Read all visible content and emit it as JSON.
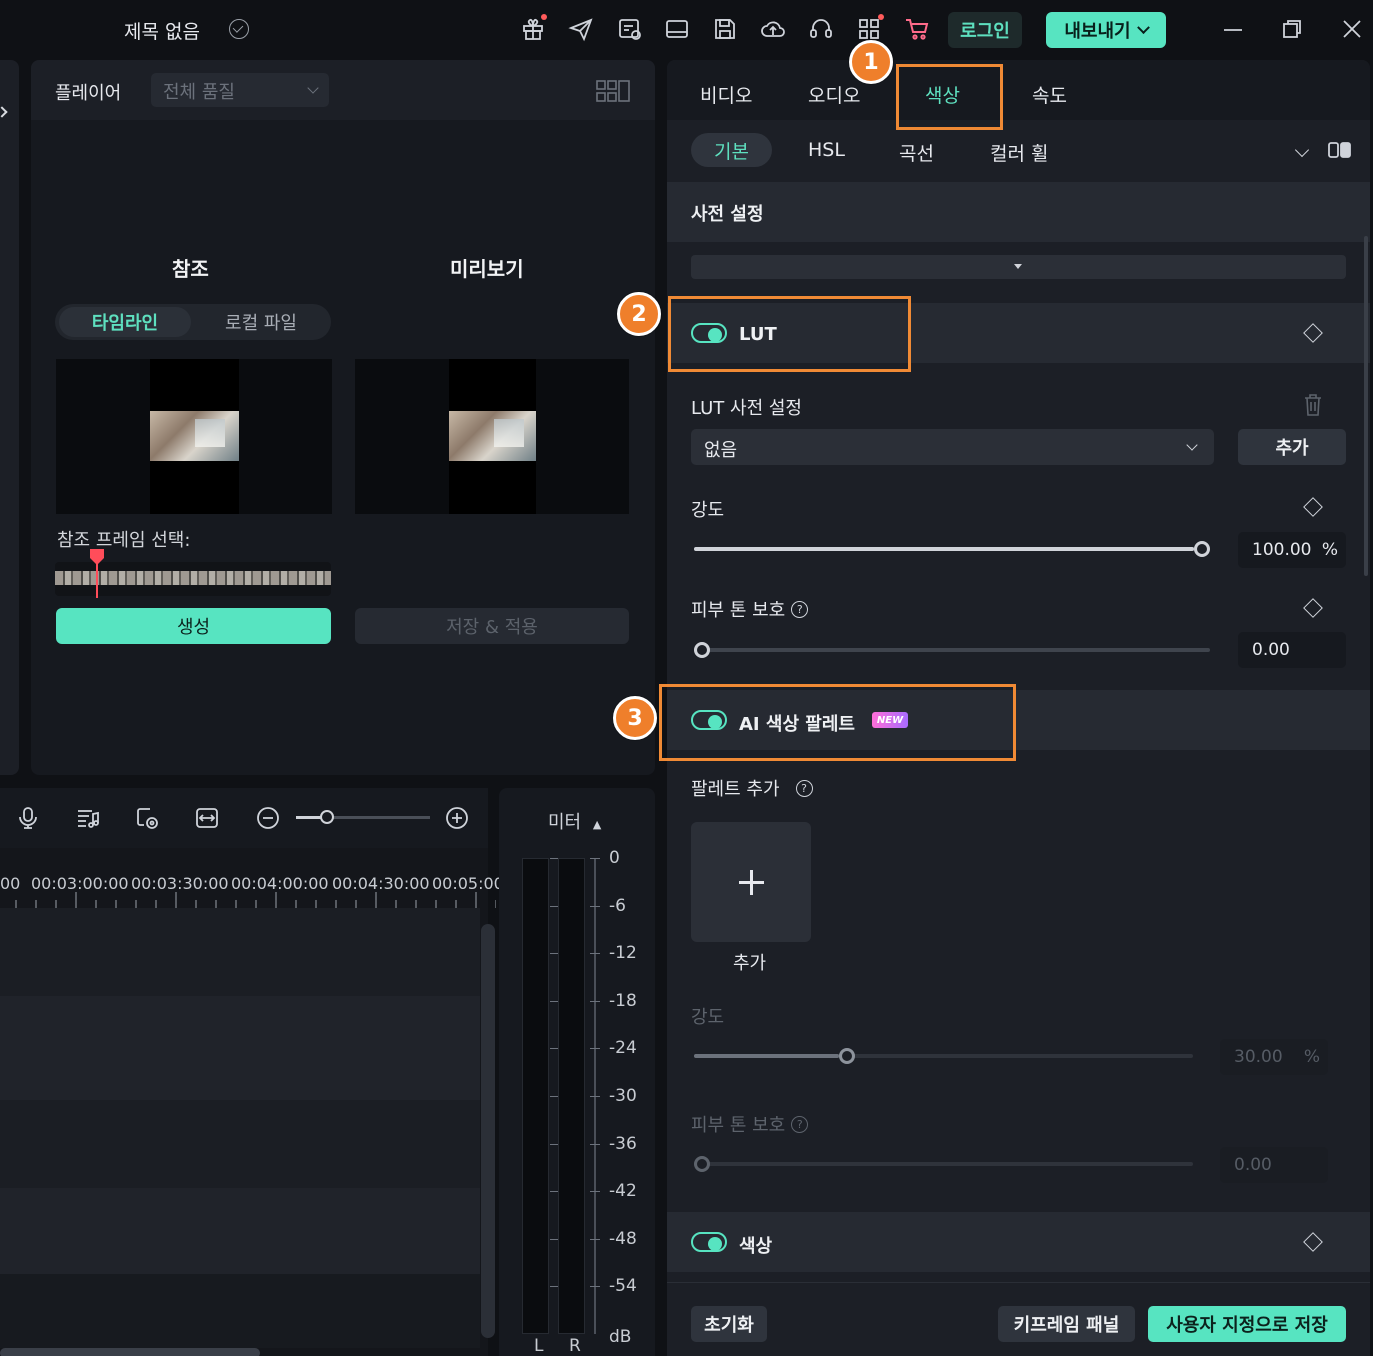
{
  "app": {
    "title": "제목 없음",
    "login_label": "로그인",
    "export_label": "내보내기",
    "accent_color": "#57e4c1"
  },
  "topbar_icons": [
    "gift-icon",
    "send-icon",
    "media-settings-icon",
    "layout-icon",
    "save-icon",
    "cloud-upload-icon",
    "headset-icon",
    "apps-grid-icon",
    "cart-icon"
  ],
  "player": {
    "label": "플레이어",
    "quality": "전체 품질",
    "reference_heading": "참조",
    "preview_heading": "미리보기",
    "source_tabs": [
      "타임라인",
      "로컬 파일"
    ],
    "ref_frame_label": "참조 프레임 선택:",
    "generate_label": "생성",
    "save_apply_label": "저장 & 적용"
  },
  "timeline": {
    "ruler": [
      "00",
      "00:03:00:00",
      "00:03:30:00",
      "00:04:00:00",
      "00:04:30:00",
      "00:05:00"
    ],
    "zoom_level": 0.22
  },
  "meter": {
    "title": "미터",
    "scale": [
      "0",
      "-6",
      "-12",
      "-18",
      "-24",
      "-30",
      "-36",
      "-42",
      "-48",
      "-54"
    ],
    "unit": "dB",
    "channels": [
      "L",
      "R"
    ]
  },
  "props": {
    "tabs": [
      "비디오",
      "오디오",
      "색상",
      "속도"
    ],
    "active_tab": "색상",
    "subtabs": [
      "기본",
      "HSL",
      "곡선",
      "컬러 휠"
    ],
    "preset_section": "사전 설정",
    "lut": {
      "title": "LUT",
      "enabled": true,
      "preset_label": "LUT 사전 설정",
      "preset_value": "없음",
      "add_label": "추가",
      "intensity_label": "강도",
      "intensity_value": "100.00",
      "intensity_unit": "%",
      "intensity_fraction": 1.0,
      "skin_label": "피부 톤 보호",
      "skin_value": "0.00",
      "skin_fraction": 0.0
    },
    "ai_palette": {
      "title": "AI 색상 팔레트",
      "badge": "NEW",
      "enabled": true,
      "add_palette_label": "팔레트 추가",
      "add_card_label": "추가",
      "intensity_label": "강도",
      "intensity_value": "30.00",
      "intensity_unit": "%",
      "intensity_fraction": 0.3,
      "skin_label": "피부 톤 보호",
      "skin_value": "0.00",
      "skin_fraction": 0.0
    },
    "color_section": {
      "title": "색상",
      "enabled": true
    },
    "footer": {
      "reset_label": "초기화",
      "keyframe_label": "키프레임 패널",
      "save_custom_label": "사용자 지정으로 저장"
    }
  },
  "annotations": [
    "1",
    "2",
    "3"
  ]
}
